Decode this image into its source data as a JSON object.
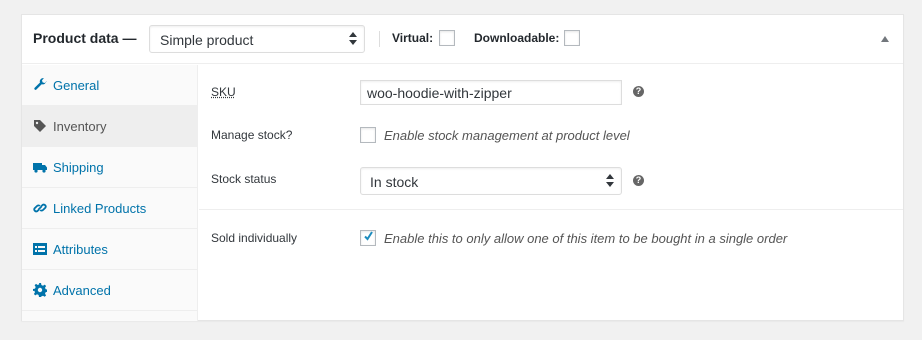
{
  "header": {
    "title": "Product data —",
    "product_type": "Simple product",
    "virtual_label": "Virtual:",
    "downloadable_label": "Downloadable:"
  },
  "tabs": [
    {
      "label": "General",
      "icon": "wrench-icon",
      "active": false
    },
    {
      "label": "Inventory",
      "icon": "tag-icon",
      "active": true
    },
    {
      "label": "Shipping",
      "icon": "truck-icon",
      "active": false
    },
    {
      "label": "Linked Products",
      "icon": "link-icon",
      "active": false
    },
    {
      "label": "Attributes",
      "icon": "list-icon",
      "active": false
    },
    {
      "label": "Advanced",
      "icon": "gear-icon",
      "active": false
    }
  ],
  "inventory": {
    "sku_label": "SKU",
    "sku_value": "woo-hoodie-with-zipper",
    "manage_stock_label": "Manage stock?",
    "manage_stock_desc": "Enable stock management at product level",
    "manage_stock_checked": false,
    "stock_status_label": "Stock status",
    "stock_status_value": "In stock",
    "sold_individually_label": "Sold individually",
    "sold_individually_desc": "Enable this to only allow one of this item to be bought in a single order",
    "sold_individually_checked": true,
    "help_glyph": "?"
  },
  "colors": {
    "link": "#0073aa",
    "text": "#23282d",
    "border": "#ddd"
  }
}
